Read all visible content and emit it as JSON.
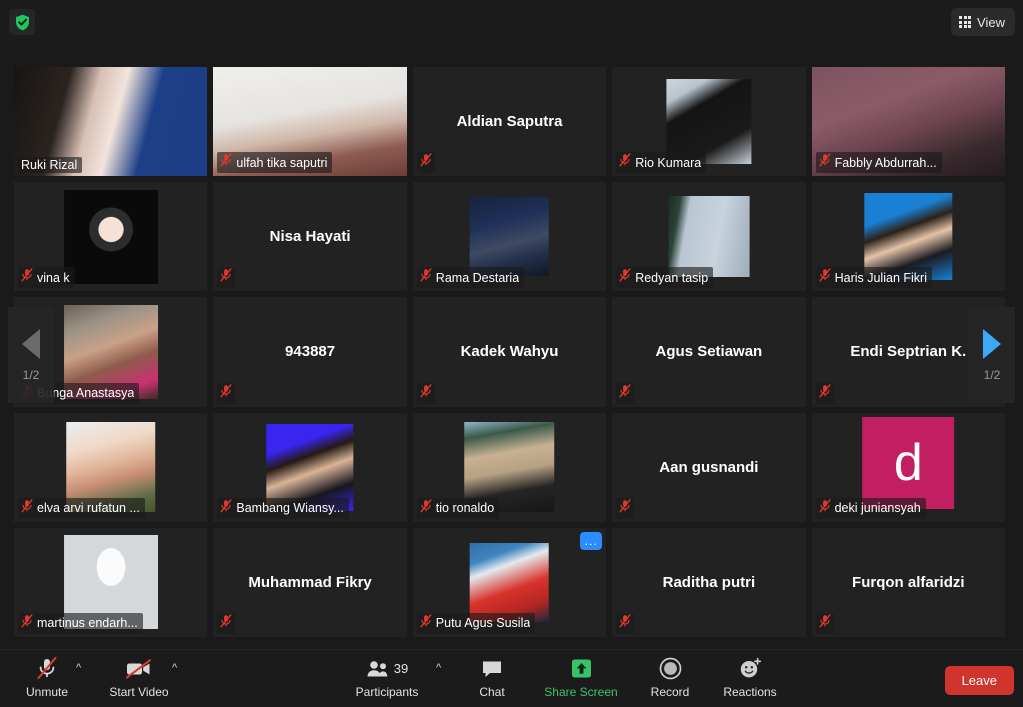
{
  "topbar": {
    "encryption_icon": "shield-check-icon",
    "view_button_label": "View",
    "view_button_icon": "grid-icon"
  },
  "pagination": {
    "prev_label": "1/2",
    "next_label": "1/2",
    "prev_icon": "chevron-left-icon",
    "next_icon": "chevron-right-icon",
    "current_page": 1,
    "total_pages": 2
  },
  "colors": {
    "active_speaker_border": "#e9ea4c",
    "next_arrow": "#3ba9f5",
    "prev_arrow": "#6b6b6b",
    "share_screen": "#3ec26a",
    "leave_button": "#d0342c",
    "more_button": "#2d8cff",
    "muted_mic": "#e0392e",
    "deki_avatar": "#c41e62"
  },
  "grid": {
    "columns": 5,
    "rows": 5,
    "mic_muted_icon": "mic-muted-icon",
    "participants": [
      {
        "name": "Ruki Rizal",
        "name_position": "footer",
        "muted": false,
        "active_speaker": true,
        "media": "video-person-banner"
      },
      {
        "name": "ulfah tika saputri",
        "name_position": "footer",
        "muted": true,
        "active_speaker": false,
        "media": "video-person-hijab"
      },
      {
        "name": "Aldian Saputra",
        "name_position": "center",
        "muted": true,
        "active_speaker": false,
        "media": "none"
      },
      {
        "name": "Rio Kumara",
        "name_position": "footer",
        "muted": true,
        "active_speaker": false,
        "media": "avatar-flag"
      },
      {
        "name": "Fabbly Abdurrah...",
        "name_position": "footer",
        "muted": true,
        "active_speaker": false,
        "media": "video-person-maroon"
      },
      {
        "name": "vina k",
        "name_position": "footer",
        "muted": true,
        "active_speaker": false,
        "media": "avatar-cartoon"
      },
      {
        "name": "Nisa Hayati",
        "name_position": "center",
        "muted": true,
        "active_speaker": false,
        "media": "none"
      },
      {
        "name": "Rama Destaria",
        "name_position": "footer",
        "muted": true,
        "active_speaker": false,
        "media": "video-person-blue-room"
      },
      {
        "name": "Redyan tasip",
        "name_position": "footer",
        "muted": true,
        "active_speaker": false,
        "media": "video-sky"
      },
      {
        "name": "Haris Julian Fikri",
        "name_position": "footer",
        "muted": true,
        "active_speaker": false,
        "media": "avatar-id-photo-blue"
      },
      {
        "name": "Bunga Anastasya",
        "name_position": "footer",
        "muted": true,
        "active_speaker": false,
        "media": "avatar-person-hood"
      },
      {
        "name": "943887",
        "name_position": "center",
        "muted": true,
        "active_speaker": false,
        "media": "none"
      },
      {
        "name": "Kadek Wahyu",
        "name_position": "center",
        "muted": true,
        "active_speaker": false,
        "media": "none"
      },
      {
        "name": "Agus Setiawan",
        "name_position": "center",
        "muted": true,
        "active_speaker": false,
        "media": "none"
      },
      {
        "name": "Endi Septrian K.",
        "name_position": "center",
        "muted": true,
        "active_speaker": false,
        "media": "none"
      },
      {
        "name": "elva arvi rufatun ...",
        "name_position": "footer",
        "muted": true,
        "active_speaker": false,
        "media": "avatar-person-hijab"
      },
      {
        "name": "Bambang Wiansy...",
        "name_position": "footer",
        "muted": true,
        "active_speaker": false,
        "media": "avatar-id-photo-violet"
      },
      {
        "name": "tio ronaldo",
        "name_position": "footer",
        "muted": true,
        "active_speaker": false,
        "media": "avatar-beach"
      },
      {
        "name": "Aan gusnandi",
        "name_position": "center",
        "muted": true,
        "active_speaker": false,
        "media": "none"
      },
      {
        "name": "deki juniansyah",
        "name_position": "footer",
        "muted": true,
        "active_speaker": false,
        "media": "avatar-letter",
        "avatar_letter": "d",
        "avatar_color": "#c41e62"
      },
      {
        "name": "martinus endarh...",
        "name_position": "footer",
        "muted": true,
        "active_speaker": false,
        "media": "avatar-silhouette"
      },
      {
        "name": "Muhammad Fikry",
        "name_position": "center",
        "muted": true,
        "active_speaker": false,
        "media": "none"
      },
      {
        "name": "Putu Agus Susila",
        "name_position": "footer",
        "muted": true,
        "active_speaker": false,
        "media": "video-person-red-shirt",
        "has_more_button": true,
        "more_button_label": "..."
      },
      {
        "name": "Raditha putri",
        "name_position": "center",
        "muted": true,
        "active_speaker": false,
        "media": "none"
      },
      {
        "name": "Furqon alfaridzi",
        "name_position": "center",
        "muted": true,
        "active_speaker": false,
        "media": "none"
      }
    ]
  },
  "toolbar": {
    "audio_label": "Unmute",
    "audio_icon": "mic-muted-icon",
    "audio_caret": "^",
    "video_label": "Start Video",
    "video_icon": "camera-off-icon",
    "video_caret": "^",
    "participants_label": "Participants",
    "participants_icon": "people-icon",
    "participants_count": "39",
    "participants_caret": "^",
    "chat_label": "Chat",
    "chat_icon": "chat-bubble-icon",
    "share_label": "Share Screen",
    "share_icon": "share-up-arrow-icon",
    "record_label": "Record",
    "record_icon": "record-circle-icon",
    "reactions_label": "Reactions",
    "reactions_icon": "smiley-plus-icon",
    "leave_label": "Leave"
  }
}
